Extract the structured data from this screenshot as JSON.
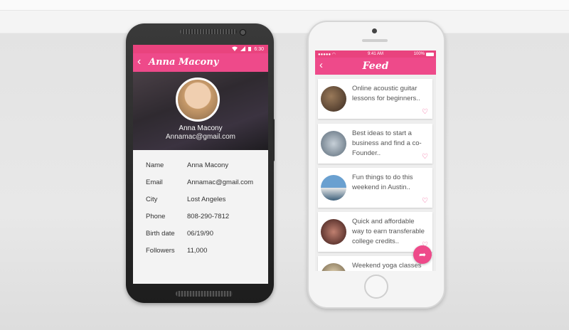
{
  "android": {
    "status_time": "6:30",
    "title": "Anna Macony",
    "profile_name": "Anna Macony",
    "profile_email": "Annamac@gmail.com",
    "details": [
      {
        "label": "Name",
        "value": "Anna Macony"
      },
      {
        "label": "Email",
        "value": "Annamac@gmail.com"
      },
      {
        "label": "City",
        "value": "Lost Angeles"
      },
      {
        "label": "Phone",
        "value": "808-290-7812"
      },
      {
        "label": "Birth date",
        "value": "06/19/90"
      },
      {
        "label": "Followers",
        "value": "11,000"
      }
    ]
  },
  "iphone": {
    "status_time": "9:41 AM",
    "status_battery": "100%",
    "title": "Feed",
    "cards": [
      {
        "text": "Online acoustic guitar lessons for beginners..",
        "thumb": "#5a4436"
      },
      {
        "text": "Best ideas to start a business and find a co-Founder..",
        "thumb": "#8a98a4"
      },
      {
        "text": "Fun things to do this weekend in Austin..",
        "thumb": "#4f7fa8"
      },
      {
        "text": "Quick and affordable way to earn transferable college credits..",
        "thumb": "#6a3a34"
      },
      {
        "text": "Weekend yoga classes",
        "thumb": "#7a6a50"
      }
    ]
  },
  "colors": {
    "accent": "#ee4a8a"
  },
  "icons": {
    "back": "‹",
    "heart": "♡",
    "share": "➦"
  }
}
